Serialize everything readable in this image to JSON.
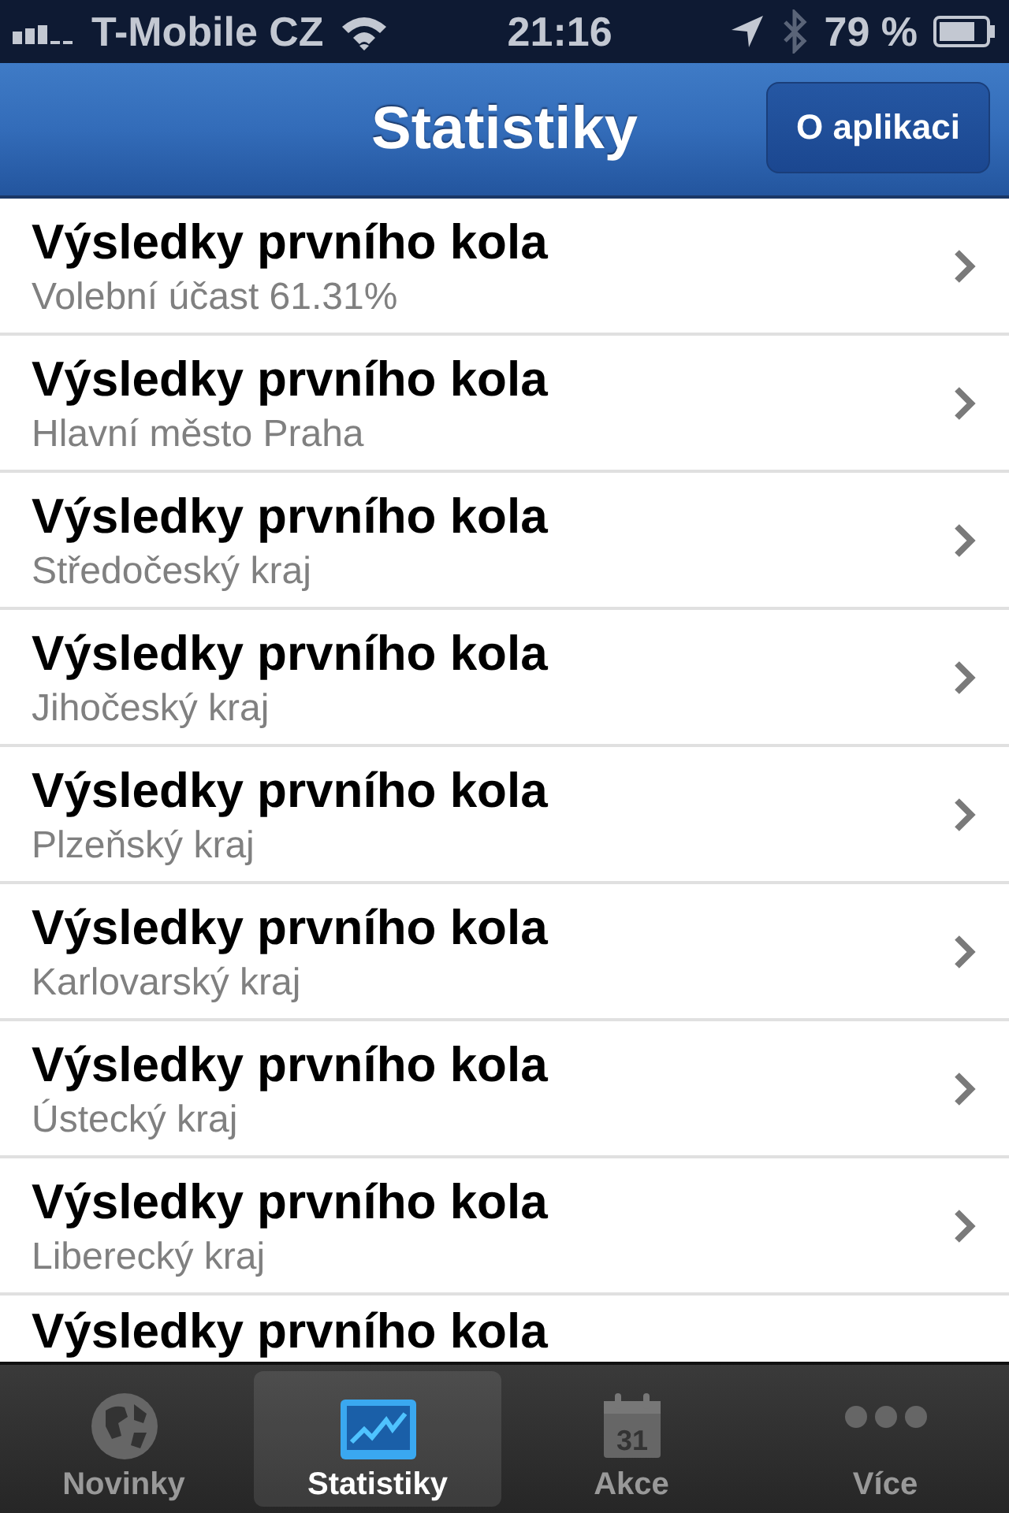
{
  "status_bar": {
    "carrier": "T-Mobile CZ",
    "time": "21:16",
    "battery": "79 %"
  },
  "nav_bar": {
    "title": "Statistiky",
    "button": "O aplikaci"
  },
  "list": [
    {
      "title": "Výsledky prvního kola",
      "subtitle": "Volební účast 61.31%"
    },
    {
      "title": "Výsledky prvního kola",
      "subtitle": "Hlavní město Praha"
    },
    {
      "title": "Výsledky prvního kola",
      "subtitle": "Středočeský kraj"
    },
    {
      "title": "Výsledky prvního kola",
      "subtitle": "Jihočeský kraj"
    },
    {
      "title": "Výsledky prvního kola",
      "subtitle": "Plzeňský kraj"
    },
    {
      "title": "Výsledky prvního kola",
      "subtitle": "Karlovarský kraj"
    },
    {
      "title": "Výsledky prvního kola",
      "subtitle": "Ústecký kraj"
    },
    {
      "title": "Výsledky prvního kola",
      "subtitle": "Liberecký kraj"
    },
    {
      "title": "Výsledky prvního kola"
    }
  ],
  "tab_bar": [
    {
      "kind": "globe",
      "label": "Novinky",
      "selected": false
    },
    {
      "kind": "chart",
      "label": "Statistiky",
      "selected": true
    },
    {
      "kind": "calendar",
      "label": "Akce",
      "selected": false,
      "icon_text": "31"
    },
    {
      "kind": "more",
      "label": "Více",
      "selected": false
    }
  ]
}
